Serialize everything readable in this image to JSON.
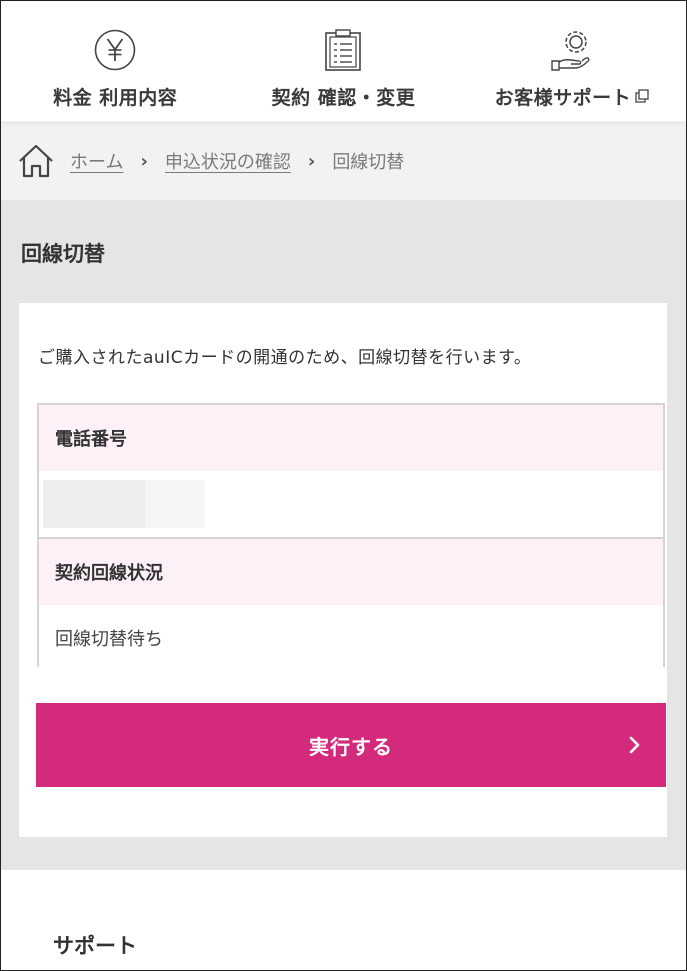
{
  "topnav": {
    "items": [
      {
        "label": "料金 利用内容",
        "icon": "yen-icon"
      },
      {
        "label": "契約 確認・変更",
        "icon": "clipboard-icon"
      },
      {
        "label": "お客様サポート",
        "icon": "support-hand-gear-icon",
        "external": true
      }
    ]
  },
  "breadcrumb": {
    "home": "ホーム",
    "middle": "申込状況の確認",
    "current": "回線切替",
    "separator": "›"
  },
  "main": {
    "title": "回線切替",
    "intro": "ご購入されたauICカードの開通のため、回線切替を行います。",
    "table": {
      "rows": [
        {
          "label": "電話番号",
          "value": ""
        },
        {
          "label": "契約回線状況",
          "value": "回線切替待ち"
        }
      ]
    },
    "execute_button": "実行する"
  },
  "footer": {
    "support_title": "サポート"
  },
  "colors": {
    "accent": "#d32a7c",
    "header_row_bg": "#fdf0f6",
    "section_bg": "#e5e5e5",
    "breadcrumb_bg": "#f2f2f2"
  }
}
